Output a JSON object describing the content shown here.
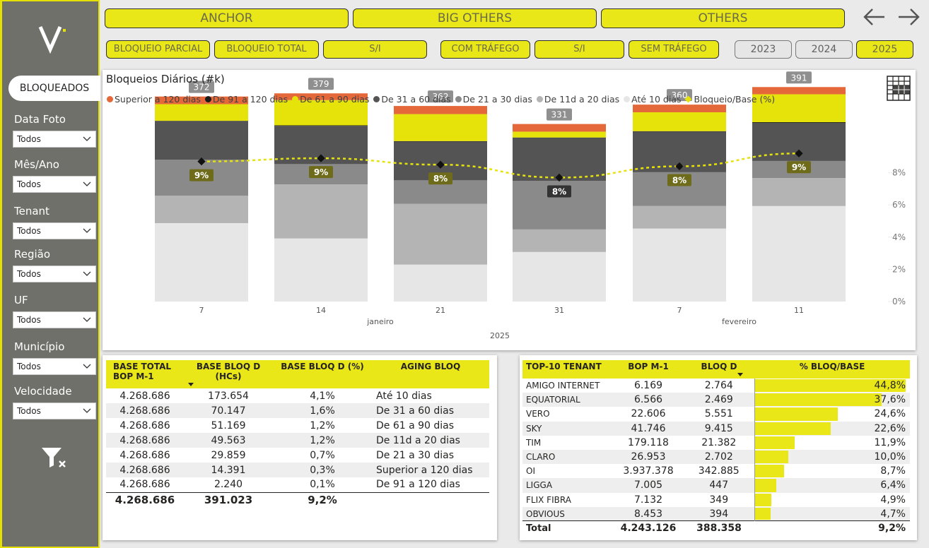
{
  "sidebar": {
    "active_tab": "BLOQUEADOS",
    "filters": [
      {
        "label": "Data Foto",
        "value": "Todos"
      },
      {
        "label": "Mês/Ano",
        "value": "Todos"
      },
      {
        "label": "Tenant",
        "value": "Todos"
      },
      {
        "label": "Região",
        "value": "Todos"
      },
      {
        "label": "UF",
        "value": "Todos"
      },
      {
        "label": "Município",
        "value": "Todos"
      },
      {
        "label": "Velocidade",
        "value": "Todos"
      }
    ]
  },
  "top_buttons": {
    "big": [
      "ANCHOR",
      "BIG OTHERS",
      "OTHERS"
    ],
    "small": [
      "BLOQUEIO PARCIAL",
      "BLOQUEIO TOTAL",
      "S/I",
      "COM TRÁFEGO",
      "S/I",
      "SEM TRÁFEGO"
    ],
    "years": [
      "2023",
      "2024",
      "2025"
    ]
  },
  "chart_data": {
    "type": "bar",
    "title": "Bloqueios Diários (#k)",
    "categories": [
      "7",
      "14",
      "21",
      "31",
      "7",
      "11"
    ],
    "x_groups": [
      {
        "label": "janeiro",
        "under": [
          0,
          3
        ]
      },
      {
        "label": "fevereiro",
        "under": [
          4,
          5
        ]
      }
    ],
    "x_year": "2025",
    "totals": [
      372,
      379,
      362,
      331,
      360,
      391
    ],
    "line_series": {
      "name": "Bloqueio/Base (%)",
      "values": [
        8.7,
        8.9,
        8.5,
        7.7,
        8.4,
        9.2
      ],
      "labels": [
        "9%",
        "9%",
        "8%",
        "8%",
        "8%",
        "9%"
      ]
    },
    "y2_ticks": [
      "0%",
      "2%",
      "4%",
      "6%",
      "8%"
    ],
    "y2lim": [
      0,
      10
    ],
    "series": [
      {
        "name": "Até 10 dias",
        "color": "#e6e6e6",
        "values": [
          174,
          140,
          82,
          110,
          162,
          212
        ]
      },
      {
        "name": "De 11d a 20 dias",
        "color": "#b4b4b4",
        "values": [
          61,
          120,
          135,
          50,
          50,
          62
        ]
      },
      {
        "name": "De 21 a 30 dias",
        "color": "#8a8a8a",
        "values": [
          80,
          45,
          52,
          108,
          75,
          38
        ]
      },
      {
        "name": "De 31 a 60 dias",
        "color": "#545454",
        "values": [
          85,
          85,
          86,
          95,
          90,
          84
        ]
      },
      {
        "name": "De 91 a 120 dias",
        "color": "#1a1a1a",
        "values": [
          1,
          1,
          1,
          1,
          1,
          2
        ]
      },
      {
        "name": "De 61 a 90 dias",
        "color": "#e6e30b",
        "values": [
          37,
          56,
          60,
          13,
          42,
          62
        ]
      },
      {
        "name": "Superior a 120 dias",
        "color": "#e5683b",
        "values": [
          17,
          15,
          18,
          17,
          17,
          16
        ]
      }
    ],
    "legend": [
      {
        "name": "Superior a 120 dias",
        "color": "#e5683b",
        "marker": "dot"
      },
      {
        "name": "De 91 a 120 dias",
        "color": "#1a1a1a",
        "marker": "dot"
      },
      {
        "name": "De 61 a 90 dias",
        "color": "#e6e30b",
        "marker": "dot"
      },
      {
        "name": "De 31 a 60 dias",
        "color": "#545454",
        "marker": "dot"
      },
      {
        "name": "De 21 a 30 dias",
        "color": "#8a8a8a",
        "marker": "dot"
      },
      {
        "name": "De 11d a 20 dias",
        "color": "#b4b4b4",
        "marker": "dot"
      },
      {
        "name": "Até 10 dias",
        "color": "#e6e6e6",
        "marker": "dot"
      },
      {
        "name": "Bloqueio/Base (%)",
        "color": "#e6e30b",
        "marker": "diamond"
      }
    ],
    "ylim": [
      0,
      420
    ]
  },
  "aging_table": {
    "headers": [
      "BASE TOTAL BOP M-1",
      "BASE BLOQ D (HCs)",
      "BASE BLOQ D (%)",
      "AGING BLOQ"
    ],
    "rows": [
      [
        "4.268.686",
        "173.654",
        "4,1%",
        "Até 10 dias"
      ],
      [
        "4.268.686",
        "70.147",
        "1,6%",
        "De 31 a 60 dias"
      ],
      [
        "4.268.686",
        "51.169",
        "1,2%",
        "De 61 a 90 dias"
      ],
      [
        "4.268.686",
        "49.563",
        "1,2%",
        "De 11d a 20 dias"
      ],
      [
        "4.268.686",
        "29.859",
        "0,7%",
        "De 21 a 30 dias"
      ],
      [
        "4.268.686",
        "14.391",
        "0,3%",
        "Superior a 120 dias"
      ],
      [
        "4.268.686",
        "2.240",
        "0,1%",
        "De 91 a 120 dias"
      ]
    ],
    "total": [
      "4.268.686",
      "391.023",
      "9,2%",
      ""
    ]
  },
  "tenant_table": {
    "headers": [
      "TOP-10 TENANT",
      "BOP M-1",
      "BLOQ D",
      "% BLOQ/BASE"
    ],
    "rows": [
      {
        "name": "AMIGO INTERNET",
        "bop": "6.169",
        "bloq": "2.764",
        "pct": "44,8%",
        "value": 44.8
      },
      {
        "name": "EQUATORIAL",
        "bop": "6.566",
        "bloq": "2.469",
        "pct": "37,6%",
        "value": 37.6
      },
      {
        "name": "VERO",
        "bop": "22.606",
        "bloq": "5.551",
        "pct": "24,6%",
        "value": 24.6
      },
      {
        "name": "SKY",
        "bop": "41.746",
        "bloq": "9.415",
        "pct": "22,6%",
        "value": 22.6
      },
      {
        "name": "TIM",
        "bop": "179.118",
        "bloq": "21.382",
        "pct": "11,9%",
        "value": 11.9
      },
      {
        "name": "CLARO",
        "bop": "26.953",
        "bloq": "2.702",
        "pct": "10,0%",
        "value": 10.0
      },
      {
        "name": "OI",
        "bop": "3.937.378",
        "bloq": "342.885",
        "pct": "8,7%",
        "value": 8.7
      },
      {
        "name": "LIGGA",
        "bop": "7.005",
        "bloq": "447",
        "pct": "6,4%",
        "value": 6.4
      },
      {
        "name": "FLIX FIBRA",
        "bop": "7.132",
        "bloq": "349",
        "pct": "4,9%",
        "value": 4.9
      },
      {
        "name": "OBVIOUS",
        "bop": "8.453",
        "bloq": "394",
        "pct": "4,7%",
        "value": 4.7
      }
    ],
    "total": {
      "name": "Total",
      "bop": "4.243.126",
      "bloq": "388.358",
      "pct": "9,2%"
    }
  }
}
